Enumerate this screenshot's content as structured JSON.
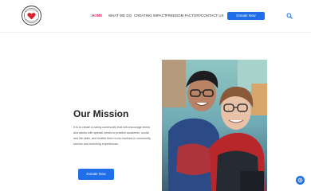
{
  "nav": {
    "items": [
      {
        "label": "HOME",
        "active": true
      },
      {
        "label": "WHAT WE DO",
        "active": false
      },
      {
        "label": "CREATING IMPACT",
        "active": false
      },
      {
        "label": "FREEDOM FACTORY",
        "active": false
      },
      {
        "label": "CONTACT US",
        "active": false
      }
    ],
    "donate_label": "Donate Now",
    "search_icon": "search-icon"
  },
  "mission": {
    "title": "Our Mission",
    "body": "It is to create a caring community that will encourage teens and adults with special needs to practice academic, social, and life skills, and enable them to be involved in community service and enriching experiences.",
    "donate_label": "Donate Now"
  },
  "colors": {
    "accent": "#1e6fe8",
    "active_nav": "#e0245e"
  }
}
